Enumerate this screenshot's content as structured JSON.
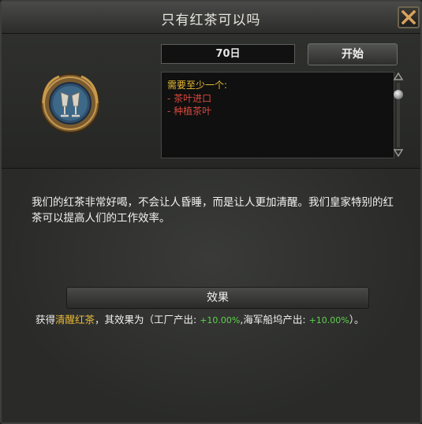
{
  "window": {
    "title": "只有红茶可以吗"
  },
  "decision": {
    "duration": "70日",
    "start_label": "开始",
    "requirements": {
      "header": "需要至少一个:",
      "items": [
        "- 茶叶进口",
        "- 种植茶叶"
      ]
    }
  },
  "description": "我们的红茶非常好喝，不会让人昏睡，而是让人更加清醒。我们皇家特别的红茶可以提高人们的工作效率。",
  "effect": {
    "header": "效果",
    "prefix": "获得",
    "modifier": "清醒红茶",
    "middle": "，其效果为（工厂产出: ",
    "factory_value": "+10.00%",
    "sep": ",海军船坞产出: ",
    "dockyard_value": "+10.00%",
    "suffix": "）。"
  },
  "colors": {
    "requirement_header": "#e7b938",
    "requirement_item": "#d9483c",
    "positive_value": "#5fd04e",
    "modifier_name": "#e7b938"
  }
}
